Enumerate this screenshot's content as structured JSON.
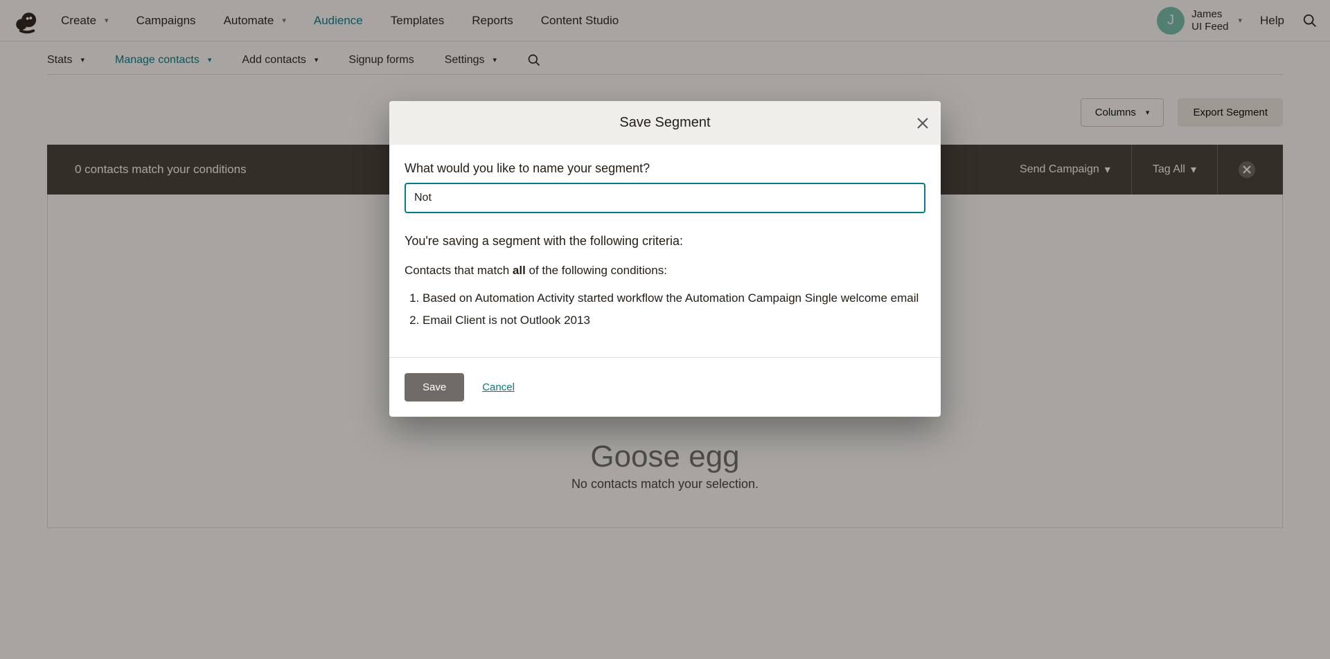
{
  "topnav": {
    "create": "Create",
    "campaigns": "Campaigns",
    "automate": "Automate",
    "audience": "Audience",
    "templates": "Templates",
    "reports": "Reports",
    "content_studio": "Content Studio",
    "user_name": "James",
    "user_sub": "UI Feed",
    "avatar_initial": "J",
    "help": "Help"
  },
  "subnav": {
    "stats": "Stats",
    "manage_contacts": "Manage contacts",
    "add_contacts": "Add contacts",
    "signup_forms": "Signup forms",
    "settings": "Settings"
  },
  "page": {
    "toggle_columns": "Columns",
    "export_segment": "Export Segment"
  },
  "darkbar": {
    "match_text": "0 contacts match your conditions",
    "send_campaign": "Send Campaign",
    "tag_all": "Tag All"
  },
  "empty": {
    "title": "Goose egg",
    "subtitle": "No contacts match your selection."
  },
  "modal": {
    "title": "Save Segment",
    "label": "What would you like to name your segment?",
    "input_value": "Not",
    "criteria_desc": "You're saving a segment with the following criteria:",
    "match_prefix": "Contacts that match ",
    "match_word": "all",
    "match_suffix": " of the following conditions:",
    "criteria": [
      "Based on Automation Activity started workflow the Automation Campaign Single welcome email",
      "Email Client is not Outlook 2013"
    ],
    "save": "Save",
    "cancel": "Cancel"
  }
}
